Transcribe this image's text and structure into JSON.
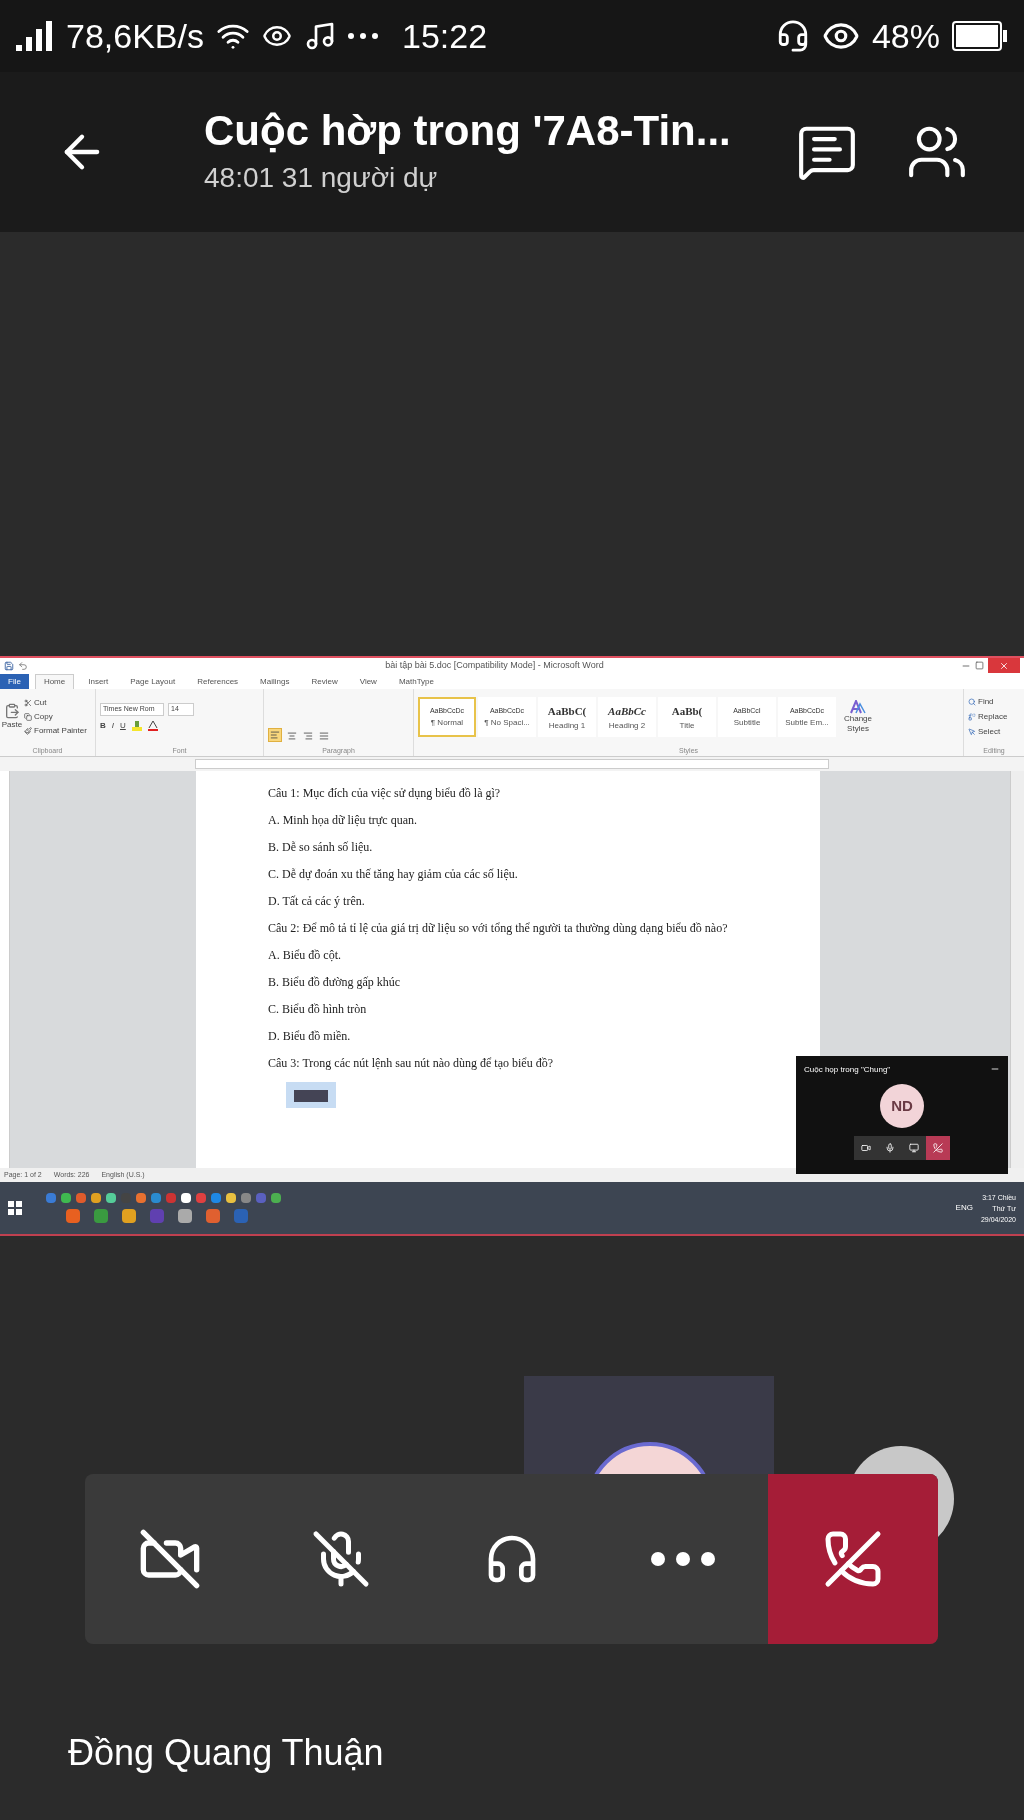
{
  "status_bar": {
    "speed": "78,6KB/s",
    "time": "15:22",
    "battery": "48%"
  },
  "header": {
    "title": "Cuộc hờp trong '7A8-Tin...",
    "subtitle": "48:01 31 người dự"
  },
  "shared_screen": {
    "word": {
      "title": "bài tập bài 5.doc [Compatibility Mode] - Microsoft Word",
      "tabs": [
        {
          "label": "File",
          "selected": false,
          "kind": "file"
        },
        {
          "label": "Home",
          "selected": true,
          "kind": "tab"
        },
        {
          "label": "Insert",
          "selected": false,
          "kind": "tab"
        },
        {
          "label": "Page Layout",
          "selected": false,
          "kind": "tab"
        },
        {
          "label": "References",
          "selected": false,
          "kind": "tab"
        },
        {
          "label": "Mailings",
          "selected": false,
          "kind": "tab"
        },
        {
          "label": "Review",
          "selected": false,
          "kind": "tab"
        },
        {
          "label": "View",
          "selected": false,
          "kind": "tab"
        },
        {
          "label": "MathType",
          "selected": false,
          "kind": "tab"
        }
      ],
      "clipboard": {
        "paste": "Paste",
        "items": [
          "Cut",
          "Copy",
          "Format Painter"
        ],
        "label": "Clipboard"
      },
      "font": {
        "name": "Times New Rom",
        "size": "14",
        "buttons": [
          "B",
          "I",
          "U"
        ],
        "label": "Font"
      },
      "paragraph": {
        "align": [
          {
            "selected": true
          },
          {
            "selected": false
          },
          {
            "selected": false
          },
          {
            "selected": false
          }
        ],
        "label": "Paragraph"
      },
      "styles": {
        "items": [
          {
            "preview": "AaBbCcDc",
            "name": "¶ Normal",
            "selected": true
          },
          {
            "preview": "AaBbCcDc",
            "name": "¶ No Spaci...",
            "selected": false
          },
          {
            "preview": "AaBbC(",
            "name": "Heading 1",
            "selected": false
          },
          {
            "preview": "AaBbCc",
            "name": "Heading 2",
            "selected": false
          },
          {
            "preview": "AaBb(",
            "name": "Title",
            "selected": false
          },
          {
            "preview": "AaBbCcI",
            "name": "Subtitle",
            "selected": false
          },
          {
            "preview": "AaBbCcDc",
            "name": "Subtle Em...",
            "selected": false
          }
        ],
        "change": "Change Styles",
        "label": "Styles"
      },
      "editing": {
        "items": [
          "Find",
          "Replace",
          "Select"
        ],
        "label": "Editing"
      },
      "document": [
        "Câu 1: Mục đích của việc sử dụng biểu đồ là gì?",
        "A. Minh họa dữ liệu trực quan.",
        "B. Dễ so sánh số liệu.",
        "C. Dễ dự đoán xu thế tăng hay giảm của các số liệu.",
        "D. Tất cả các ý trên.",
        "Câu 2: Để mô tả tỉ lệ của giá trị dữ liệu so với tổng thể người ta thường dùng dạng biểu đồ nào?",
        "A.  Biểu đồ cột.",
        "B. Biểu đồ đường gấp khúc",
        "C. Biểu đồ hình tròn",
        "D. Biểu đồ miền.",
        "Câu 3: Trong các nút lệnh sau nút nào dùng để tạo biểu đồ?"
      ],
      "status": [
        "Page: 1 of 2",
        "Words: 226",
        "English (U.S.)"
      ]
    },
    "taskbar": {
      "language": "ENG",
      "time": "3:17 Chiều",
      "day": "Thứ Tư",
      "date": "29/04/2020"
    },
    "mini_call": {
      "title": "Cuộc họp trong \"Chung\"",
      "initials": "ND"
    }
  },
  "call_controls": [
    {
      "kind": "camera",
      "on": false
    },
    {
      "kind": "mic",
      "on": false
    },
    {
      "kind": "audio",
      "on": true
    },
    {
      "kind": "more",
      "on": true
    },
    {
      "kind": "hangup",
      "on": true
    }
  ],
  "participant": {
    "name": "Đồng Quang Thuận"
  }
}
